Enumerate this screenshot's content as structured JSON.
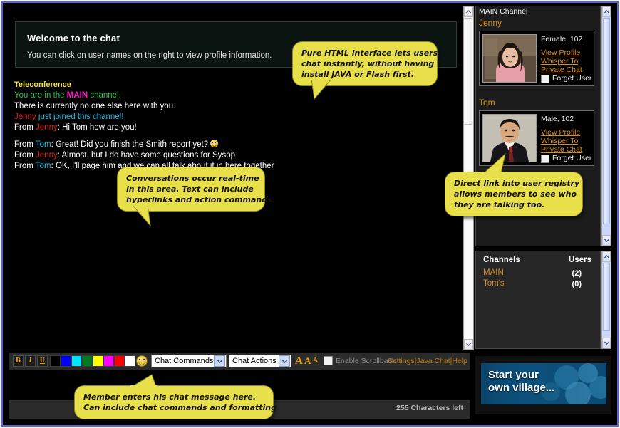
{
  "welcome": {
    "title": "Welcome to the chat",
    "subtitle": "You can click on user names on the right to view profile information."
  },
  "transcript": {
    "header": "Teleconference",
    "lines": [
      {
        "segments": [
          {
            "text": "You are in the ",
            "color": "green"
          },
          {
            "text": "MAIN",
            "color": "magenta"
          },
          {
            "text": " channel.",
            "color": "green"
          }
        ]
      },
      {
        "segments": [
          {
            "text": "There is currently no one else here with you.",
            "color": "white"
          }
        ]
      },
      {
        "segments": [
          {
            "text": "Jenny",
            "color": "red"
          },
          {
            "text": " just joined this channel!",
            "color": "cyan"
          }
        ]
      },
      {
        "segments": [
          {
            "text": "From ",
            "color": "white"
          },
          {
            "text": "Jenny",
            "color": "red"
          },
          {
            "text": ": Hi Tom how are you!",
            "color": "white"
          }
        ]
      },
      {
        "gap": true
      },
      {
        "segments": [
          {
            "text": "From ",
            "color": "white"
          },
          {
            "text": "Tom",
            "color": "cyan"
          },
          {
            "text": ": Great! Did you finish the Smith report yet?",
            "color": "white"
          }
        ],
        "smiley": true
      },
      {
        "segments": [
          {
            "text": "From ",
            "color": "white"
          },
          {
            "text": "Jenny",
            "color": "red"
          },
          {
            "text": ": Almost, but I do have some questions for Sysop",
            "color": "white"
          }
        ]
      },
      {
        "segments": [
          {
            "text": "From ",
            "color": "white"
          },
          {
            "text": "Tom",
            "color": "cyan"
          },
          {
            "text": ": OK, I'll page him and we can all talk about it in here together",
            "color": "white"
          }
        ]
      }
    ]
  },
  "toolbar": {
    "bold_label": "B",
    "italic_label": "I",
    "underline_label": "U",
    "colors": [
      "#000000",
      "#0000ff",
      "#00e5ff",
      "#007a1e",
      "#ffff00",
      "#ff00ff",
      "#ff0000",
      "#ffffff"
    ],
    "emoji_label": "smiley",
    "commands_select": "Chat Commands",
    "actions_select": "Chat Actions",
    "font_sizes": [
      "A",
      "A",
      "A"
    ],
    "scrollback_label": "Enable Scrollback",
    "links": [
      "Settings",
      "Java Chat",
      "Help"
    ],
    "link_separator": "|"
  },
  "input": {
    "value": "",
    "placeholder": "",
    "chars_left": "255 Characters left"
  },
  "sidebar": {
    "panel_title": "MAIN Channel",
    "users": [
      {
        "name": "Jenny",
        "meta": "Female, 102",
        "links": [
          "View Profile",
          "Whisper To",
          "Private Chat"
        ],
        "forget_label": "Forget User",
        "forget_checked": false
      },
      {
        "name": "Tom",
        "meta": "Male, 102",
        "links": [
          "View Profile",
          "Whisper To",
          "Private Chat"
        ],
        "forget_label": "Forget User",
        "forget_checked": false
      }
    ],
    "channels": {
      "col_channels": "Channels",
      "col_users": "Users",
      "rows": [
        {
          "name": "MAIN",
          "count": "(2)"
        },
        {
          "name": "Tom's",
          "count": "(0)"
        }
      ]
    },
    "ad": {
      "line1": "Start your",
      "line2": "own village..."
    }
  },
  "callouts": [
    {
      "id": "callout-html-interface",
      "lines": [
        "Pure HTML interface lets users",
        "chat instantly, without having to",
        "install JAVA or Flash first."
      ]
    },
    {
      "id": "callout-conversation-area",
      "lines": [
        "Conversations occur real-time",
        "in this area. Text can include",
        "hyperlinks and action commands."
      ]
    },
    {
      "id": "callout-user-registry",
      "lines": [
        "Direct link into user registry",
        "allows members to see who",
        "they are talking too."
      ]
    },
    {
      "id": "callout-message-entry",
      "lines": [
        "Member enters his chat message here.",
        "Can include chat commands and formatting"
      ]
    }
  ],
  "colors": {
    "bubble_fill": "#e8e04a",
    "accent_orange": "#d98f1f",
    "header_yellow": "#f2e34a",
    "frame_blue": "#5b63c9"
  }
}
